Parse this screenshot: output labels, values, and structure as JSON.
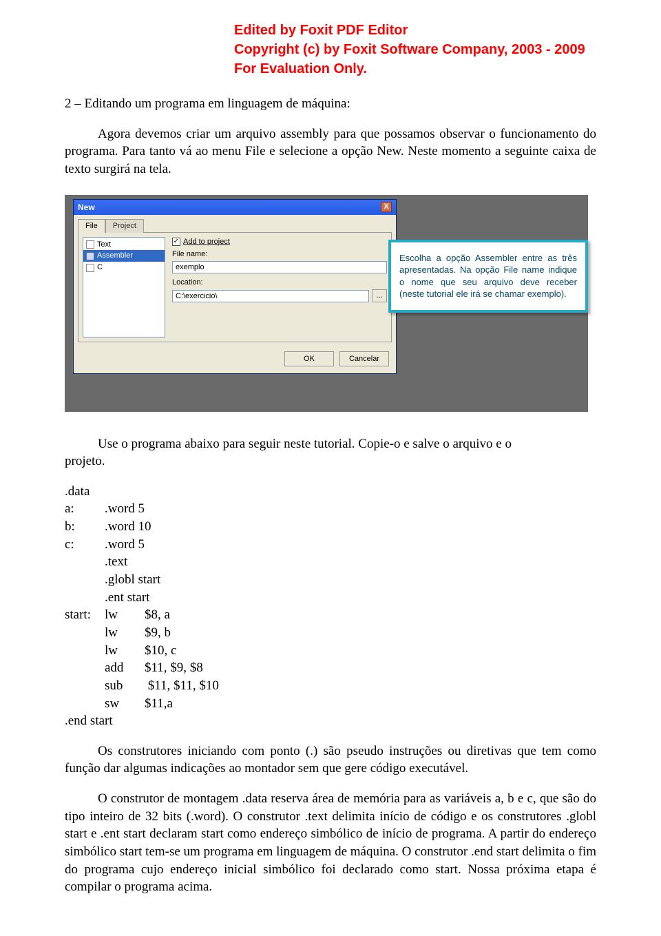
{
  "watermark": {
    "line1": "Edited by Foxit PDF Editor",
    "line2": "Copyright (c) by Foxit Software Company, 2003 - 2009",
    "line3": "For Evaluation Only."
  },
  "heading": "2 – Editando um programa em linguagem de máquina:",
  "para_intro": "Agora devemos criar um arquivo assembly para que possamos observar o funcionamento do programa. Para tanto vá ao menu File e selecione a opção New. Neste momento a seguinte caixa de texto surgirá na tela.",
  "dialog": {
    "title": "New",
    "close": "X",
    "tab_file": "File",
    "tab_project": "Project",
    "list": {
      "text": "Text",
      "assembler": "Assembler",
      "c": "C"
    },
    "add_to_project_label": "Add to project",
    "add_to_project_checked": "✓",
    "file_name_label": "File name:",
    "file_name_value": "exemplo",
    "location_label": "Location:",
    "location_value": "C:\\exercicio\\",
    "browse_label": "...",
    "ok_label": "OK",
    "cancel_label": "Cancelar"
  },
  "callout_text": "Escolha a opção Assembler entre as três apresentadas. Na opção File name indique o nome que seu arquivo deve receber (neste tutorial ele irá se chamar exemplo).",
  "para_use": "Use o programa abaixo para seguir neste tutorial. Copie-o e salve o arquivo e o",
  "para_use_tail": "projeto.",
  "code": {
    "l1": ".data",
    "l2a": "a:",
    "l2b": ".word 5",
    "l3a": "b:",
    "l3b": ".word 10",
    "l4a": "c:",
    "l4b": ".word 5",
    "l5": ".text",
    "l6": ".globl start",
    "l7": ".ent start",
    "l8a": "start:",
    "l8b": "lw",
    "l8c": "$8, a",
    "l9b": "lw",
    "l9c": "$9, b",
    "l10b": "lw",
    "l10c": "$10, c",
    "l11b": "add",
    "l11c": "$11, $9, $8",
    "l12b": "sub",
    "l12c": " $11, $11, $10",
    "l13b": "sw",
    "l13c": "$11,a",
    "l14": ".end start"
  },
  "para_constr1": "Os construtores iniciando com ponto (.) são pseudo instruções ou diretivas que tem como função dar algumas indicações ao montador sem que gere código executável.",
  "para_constr2": "O construtor de montagem .data reserva área de memória para as variáveis a, b e c, que são do tipo inteiro de 32 bits (.word). O construtor .text delimita início de código e os construtores .globl start e .ent start declaram start como endereço simbólico de início de programa. A partir do endereço simbólico start tem-se um programa em linguagem de máquina. O construtor .end start delimita o fim do programa cujo endereço inicial simbólico foi declarado como start. Nossa próxima etapa é compilar o programa acima."
}
